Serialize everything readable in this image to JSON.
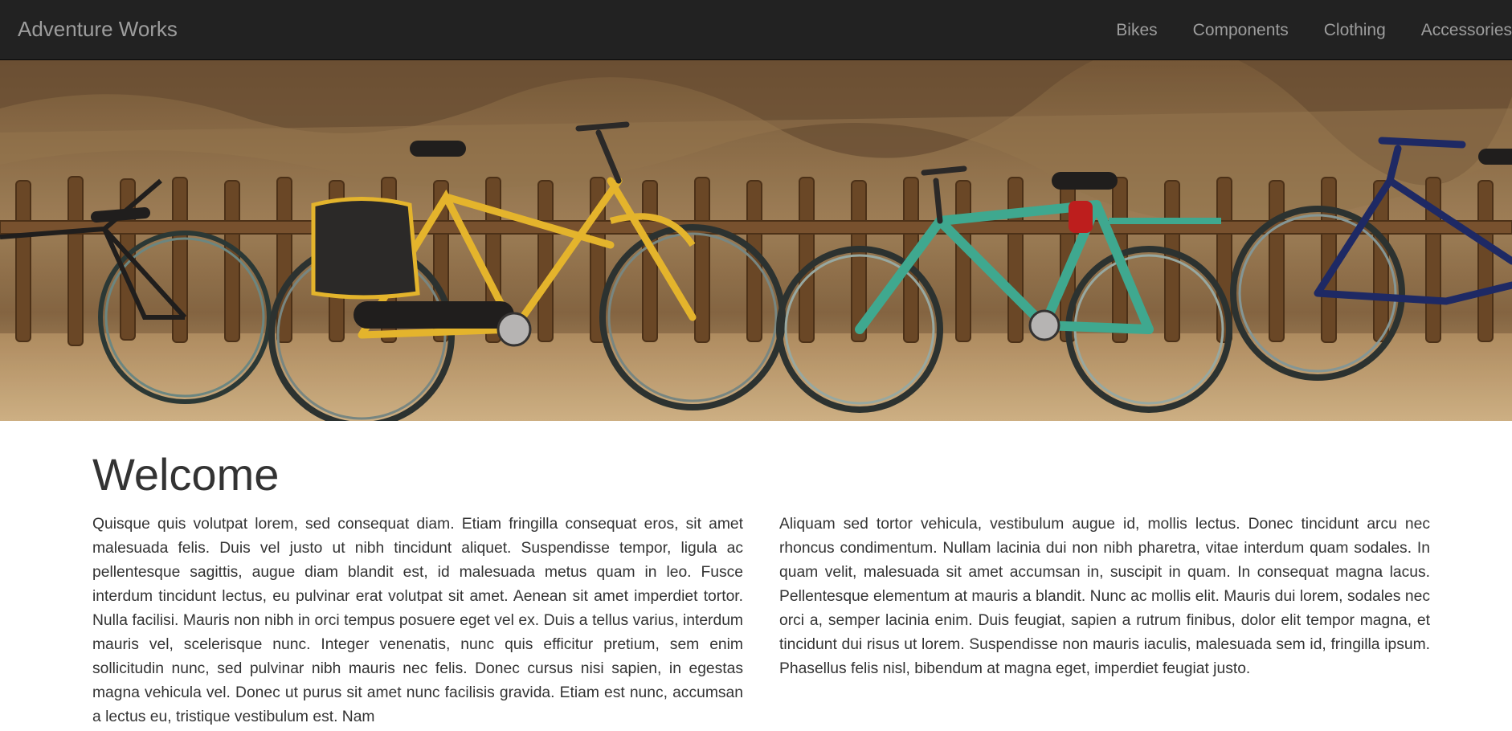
{
  "navbar": {
    "brand": "Adventure Works",
    "links": [
      "Bikes",
      "Components",
      "Clothing",
      "Accessories"
    ]
  },
  "hero": {
    "image": "bicycles-leaning-on-wooden-fence-photo"
  },
  "main": {
    "heading": "Welcome",
    "paragraph_left": "Quisque quis volutpat lorem, sed consequat diam. Etiam fringilla consequat eros, sit amet malesuada felis. Duis vel justo ut nibh tincidunt aliquet. Suspendisse tempor, ligula ac pellentesque sagittis, augue diam blandit est, id malesuada metus quam in leo. Fusce interdum tincidunt lectus, eu pulvinar erat volutpat sit amet. Aenean sit amet imperdiet tortor. Nulla facilisi. Mauris non nibh in orci tempus posuere eget vel ex. Duis a tellus varius, interdum mauris vel, scelerisque nunc. Integer venenatis, nunc quis efficitur pretium, sem enim sollicitudin nunc, sed pulvinar nibh mauris nec felis. Donec cursus nisi sapien, in egestas magna vehicula vel. Donec ut purus sit amet nunc facilisis gravida. Etiam est nunc, accumsan a lectus eu, tristique vestibulum est. Nam",
    "paragraph_right": "Aliquam sed tortor vehicula, vestibulum augue id, mollis lectus. Donec tincidunt arcu nec rhoncus condimentum. Nullam lacinia dui non nibh pharetra, vitae interdum quam sodales. In quam velit, malesuada sit amet accumsan in, suscipit in quam. In consequat magna lacus. Pellentesque elementum at mauris a blandit. Nunc ac mollis elit. Mauris dui lorem, sodales nec orci a, semper lacinia enim. Duis feugiat, sapien a rutrum finibus, dolor elit tempor magna, et tincidunt dui risus ut lorem. Suspendisse non mauris iaculis, malesuada sem id, fringilla ipsum. Phasellus felis nisl, bibendum at magna eget, imperdiet feugiat justo."
  },
  "colors": {
    "navbar_bg": "#222222",
    "nav_text": "#9d9d9d",
    "body_text": "#333333",
    "bike_yellow": "#f2c12e",
    "bike_teal": "#3fb49a",
    "bike_navy": "#1c2a6b",
    "bike_black": "#1e1e1e"
  }
}
